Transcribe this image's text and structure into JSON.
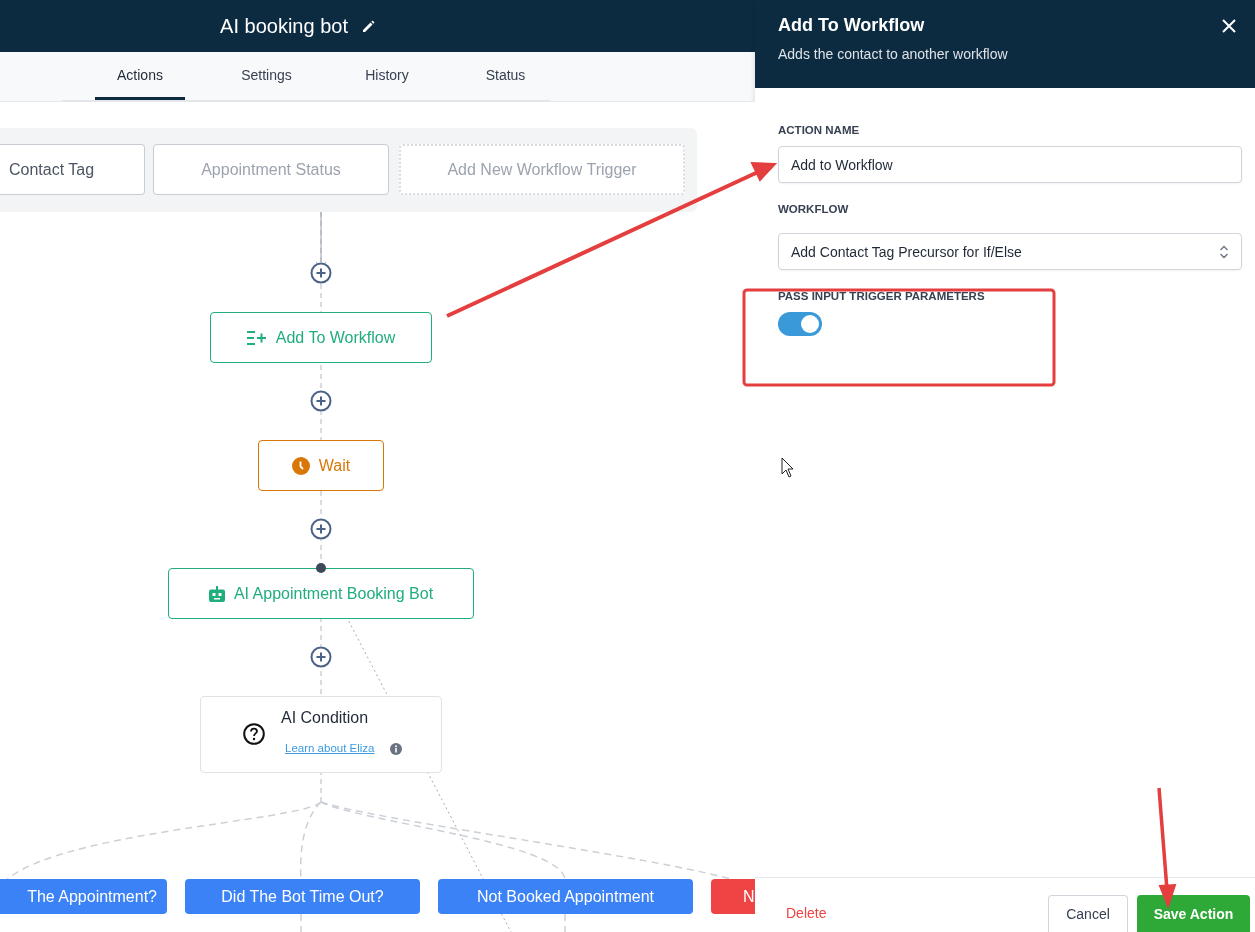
{
  "header": {
    "title": "AI booking bot"
  },
  "tabs": [
    {
      "label": "Actions",
      "selected": true
    },
    {
      "label": "Settings",
      "selected": false
    },
    {
      "label": "History",
      "selected": false
    },
    {
      "label": "Status",
      "selected": false
    }
  ],
  "triggers": [
    {
      "label": "Contact Tag",
      "kind": "trigger"
    },
    {
      "label": "Appointment Status",
      "kind": "muted"
    },
    {
      "label": "Add New Workflow Trigger",
      "kind": "add"
    }
  ],
  "actions": [
    {
      "label": "Add To Workflow",
      "kind": "workflow"
    },
    {
      "label": "Wait",
      "kind": "wait"
    },
    {
      "label": "AI Appointment Booking Bot",
      "kind": "bot"
    }
  ],
  "condition": {
    "title": "AI Condition",
    "link": "Learn about Eliza"
  },
  "branches": [
    {
      "label": "The Appointment?",
      "color": "#3b82f6"
    },
    {
      "label": "Did The Bot Time Out?",
      "color": "#3b82f6"
    },
    {
      "label": "Not Booked Appointment",
      "color": "#3b82f6"
    },
    {
      "label": "N",
      "color": "#ef4444"
    }
  ],
  "panel": {
    "title": "Add To Workflow",
    "subtitle": "Adds the contact to another workflow",
    "fields": [
      {
        "label": "ACTION NAME",
        "kind": "text",
        "value": "Add to Workflow"
      },
      {
        "label": "WORKFLOW",
        "kind": "select",
        "value": "Add Contact Tag Precursor for If/Else"
      },
      {
        "label": "PASS INPUT TRIGGER PARAMETERS",
        "kind": "toggle",
        "on": true
      }
    ],
    "delete": "Delete",
    "cancel": "Cancel",
    "save": "Save Action"
  }
}
